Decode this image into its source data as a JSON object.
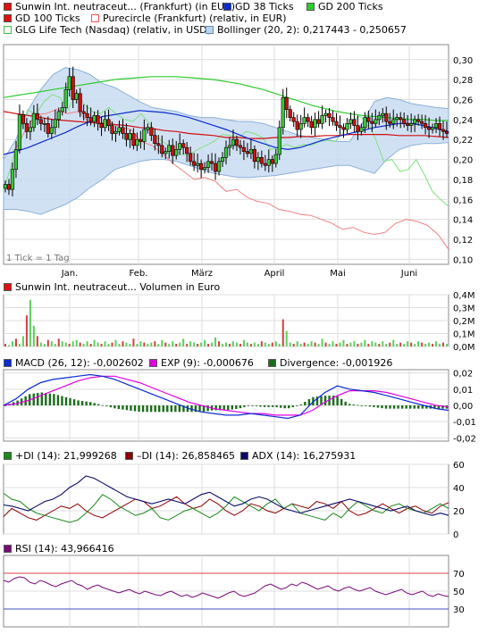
{
  "chart_data": [
    {
      "type": "candlestick",
      "legend": [
        {
          "label": "Sunwin Int. neutraceut... (Frankfurt) (in EUR)",
          "color": "#e01010",
          "style": "solid"
        },
        {
          "label": "GD 38 Ticks",
          "color": "#0a2bd0",
          "style": "solid"
        },
        {
          "label": "GD 200 Ticks",
          "color": "#2ecc2e",
          "style": "solid"
        },
        {
          "label": "GD 100 Ticks",
          "color": "#e01010",
          "style": "solid"
        },
        {
          "label": "Purecircle (Frankfurt) (relativ, in EUR)",
          "color": "#ff8080",
          "style": "solid"
        },
        {
          "label": "GLG Life Tech (Nasdaq) (relativ, in USD)",
          "color": "#8ef08e",
          "style": "solid"
        },
        {
          "label": "Bollinger (20, 2): 0,217443 - 0,250657",
          "color": "#b8d4f0",
          "style": "solid"
        }
      ],
      "tick_note": "1 Tick = 1 Tag",
      "x_labels": [
        "Jan.",
        "Feb.",
        "März",
        "April",
        "Mai",
        "Juni"
      ],
      "y_ticks": [
        "0,30",
        "0,28",
        "0,26",
        "0,24",
        "0,22",
        "0,20",
        "0,18",
        "0,16",
        "0,14",
        "0,12",
        "0,10"
      ],
      "ylim": [
        0.095,
        0.315
      ],
      "price_close": [
        0.175,
        0.17,
        0.19,
        0.21,
        0.245,
        0.236,
        0.228,
        0.232,
        0.246,
        0.24,
        0.236,
        0.236,
        0.226,
        0.232,
        0.24,
        0.248,
        0.252,
        0.27,
        0.283,
        0.26,
        0.266,
        0.248,
        0.246,
        0.242,
        0.238,
        0.244,
        0.236,
        0.232,
        0.24,
        0.234,
        0.226,
        0.228,
        0.232,
        0.226,
        0.22,
        0.226,
        0.214,
        0.22,
        0.218,
        0.23,
        0.232,
        0.224,
        0.216,
        0.214,
        0.206,
        0.208,
        0.214,
        0.204,
        0.21,
        0.216,
        0.212,
        0.206,
        0.198,
        0.194,
        0.196,
        0.19,
        0.192,
        0.198,
        0.196,
        0.188,
        0.198,
        0.202,
        0.212,
        0.214,
        0.22,
        0.214,
        0.212,
        0.208,
        0.206,
        0.21,
        0.198,
        0.202,
        0.196,
        0.194,
        0.2,
        0.196,
        0.205,
        0.232,
        0.262,
        0.25,
        0.242,
        0.238,
        0.23,
        0.236,
        0.242,
        0.238,
        0.232,
        0.24,
        0.236,
        0.244,
        0.246,
        0.242,
        0.238,
        0.234,
        0.232,
        0.23,
        0.236,
        0.24,
        0.234,
        0.228,
        0.232,
        0.242,
        0.238,
        0.236,
        0.24,
        0.244,
        0.246,
        0.238,
        0.236,
        0.24,
        0.242,
        0.24,
        0.236,
        0.234,
        0.236,
        0.24,
        0.238,
        0.236,
        0.232,
        0.23,
        0.232,
        0.236,
        0.23,
        0.228,
        0.226
      ],
      "gd38": [
        0.205,
        0.208,
        0.212,
        0.217,
        0.222,
        0.227,
        0.233,
        0.238,
        0.243,
        0.245,
        0.247,
        0.249,
        0.248,
        0.247,
        0.245,
        0.242,
        0.238,
        0.234,
        0.23,
        0.225,
        0.22,
        0.216,
        0.212,
        0.21,
        0.212,
        0.216,
        0.22,
        0.223,
        0.226,
        0.229,
        0.232,
        0.234,
        0.236,
        0.236,
        0.234,
        0.231,
        0.228
      ],
      "gd100": [
        0.248,
        0.246,
        0.244,
        0.242,
        0.24,
        0.239,
        0.238,
        0.237,
        0.236,
        0.235,
        0.234,
        0.232,
        0.231,
        0.229,
        0.228,
        0.226,
        0.225,
        0.224,
        0.222,
        0.222,
        0.221,
        0.221,
        0.222,
        0.222,
        0.223,
        0.223,
        0.224,
        0.224,
        0.225,
        0.225,
        0.225,
        0.225,
        0.224,
        0.224,
        0.224,
        0.223,
        0.222
      ],
      "gd200": [
        0.262,
        0.264,
        0.266,
        0.268,
        0.27,
        0.272,
        0.274,
        0.276,
        0.278,
        0.28,
        0.281,
        0.282,
        0.283,
        0.283,
        0.283,
        0.282,
        0.281,
        0.28,
        0.278,
        0.276,
        0.273,
        0.27,
        0.266,
        0.262,
        0.258,
        0.254,
        0.251,
        0.248,
        0.246,
        0.244,
        0.243,
        0.242,
        0.241,
        0.24,
        0.24,
        0.239,
        0.239
      ],
      "purecircle": [
        0.205,
        0.208,
        0.228,
        0.245,
        0.246,
        0.25,
        0.246,
        0.248,
        0.238,
        0.236,
        0.238,
        0.232,
        0.23,
        0.218,
        0.214,
        0.206,
        0.196,
        0.188,
        0.18,
        0.182,
        0.178,
        0.168,
        0.17,
        0.162,
        0.158,
        0.156,
        0.15,
        0.148,
        0.145,
        0.144,
        0.14,
        0.136,
        0.13,
        0.132,
        0.127,
        0.125,
        0.127,
        0.136,
        0.14,
        0.138,
        0.134,
        0.125,
        0.11
      ],
      "glg": [
        0.17,
        0.195,
        0.23,
        0.25,
        0.245,
        0.258,
        0.265,
        0.262,
        0.25,
        0.268,
        0.255,
        0.248,
        0.246,
        0.252,
        0.245,
        0.24,
        0.238,
        0.246,
        0.236,
        0.222,
        0.216,
        0.21,
        0.205,
        0.205,
        0.21,
        0.214,
        0.218,
        0.225,
        0.224,
        0.222,
        0.228,
        0.226,
        0.222,
        0.21,
        0.212,
        0.215,
        0.212,
        0.215,
        0.214,
        0.218,
        0.219,
        0.218,
        0.228,
        0.238,
        0.243,
        0.238,
        0.22,
        0.198,
        0.2,
        0.188,
        0.19,
        0.2,
        0.185,
        0.168,
        0.16,
        0.153
      ],
      "boll_upper": [
        0.2,
        0.22,
        0.25,
        0.27,
        0.285,
        0.292,
        0.29,
        0.285,
        0.276,
        0.272,
        0.265,
        0.258,
        0.252,
        0.25,
        0.248,
        0.244,
        0.242,
        0.242,
        0.24,
        0.238,
        0.238,
        0.236,
        0.232,
        0.228,
        0.224,
        0.222,
        0.22,
        0.218,
        0.218,
        0.236,
        0.258,
        0.262,
        0.26,
        0.256,
        0.254,
        0.252,
        0.251
      ],
      "boll_lower": [
        0.15,
        0.15,
        0.148,
        0.145,
        0.15,
        0.155,
        0.162,
        0.172,
        0.18,
        0.19,
        0.194,
        0.198,
        0.2,
        0.2,
        0.198,
        0.194,
        0.19,
        0.186,
        0.184,
        0.182,
        0.182,
        0.183,
        0.184,
        0.186,
        0.188,
        0.19,
        0.192,
        0.194,
        0.194,
        0.19,
        0.186,
        0.2,
        0.21,
        0.214,
        0.216,
        0.216,
        0.217
      ]
    },
    {
      "type": "bar",
      "title": "Sunwin Int. neutraceut... Volumen in Euro",
      "y_ticks": [
        "0,4M",
        "0,3M",
        "0,2M",
        "0,1M",
        "0,0M"
      ],
      "ylim": [
        0,
        0.4
      ],
      "unit": "M EUR",
      "values": [
        0.02,
        0.01,
        0.04,
        0.06,
        0.02,
        0.08,
        0.24,
        0.36,
        0.16,
        0.08,
        0.03,
        0.02,
        0.05,
        0.04,
        0.02,
        0.06,
        0.04,
        0.03,
        0.02,
        0.04,
        0.05,
        0.03,
        0.02,
        0.04,
        0.02,
        0.05,
        0.03,
        0.02,
        0.04,
        0.02,
        0.03,
        0.05,
        0.02,
        0.04,
        0.03,
        0.02,
        0.06,
        0.02,
        0.04,
        0.03,
        0.02,
        0.03,
        0.04,
        0.02,
        0.05,
        0.03,
        0.02,
        0.04,
        0.02,
        0.03,
        0.06,
        0.02,
        0.04,
        0.03,
        0.02,
        0.03,
        0.05,
        0.02,
        0.03,
        0.07,
        0.04,
        0.02,
        0.03,
        0.02,
        0.04,
        0.03,
        0.02,
        0.05,
        0.03,
        0.02,
        0.03,
        0.02,
        0.04,
        0.03,
        0.02,
        0.03,
        0.04,
        0.02,
        0.21,
        0.12,
        0.03,
        0.02,
        0.04,
        0.02,
        0.03,
        0.02,
        0.04,
        0.03,
        0.02,
        0.06,
        0.03,
        0.02,
        0.04,
        0.02,
        0.03,
        0.05,
        0.02,
        0.03,
        0.04,
        0.02,
        0.03,
        0.05,
        0.02,
        0.04,
        0.03,
        0.02,
        0.04,
        0.02,
        0.03,
        0.05,
        0.02,
        0.03,
        0.02,
        0.04,
        0.03,
        0.02,
        0.04,
        0.03,
        0.02,
        0.03,
        0.02,
        0.04,
        0.02,
        0.03,
        0.02
      ]
    },
    {
      "type": "line",
      "legend": [
        {
          "label": "MACD (26, 12): -0,002602",
          "color": "#0a2bd0"
        },
        {
          "label": "EXP (9): -0,000676",
          "color": "#e000e0"
        },
        {
          "label": "Divergence: -0,001926",
          "color": "#1a6b1a"
        }
      ],
      "y_ticks": [
        "0,02",
        "0,01",
        "0,00",
        "-0,01",
        "-0,02"
      ],
      "ylim": [
        -0.022,
        0.022
      ],
      "macd": [
        0.0,
        0.004,
        0.01,
        0.014,
        0.016,
        0.017,
        0.018,
        0.019,
        0.018,
        0.016,
        0.013,
        0.01,
        0.007,
        0.004,
        0.001,
        -0.002,
        -0.004,
        -0.005,
        -0.006,
        -0.006,
        -0.005,
        -0.006,
        -0.007,
        -0.008,
        -0.006,
        0.002,
        0.008,
        0.012,
        0.01,
        0.009,
        0.008,
        0.006,
        0.004,
        0.002,
        0.0,
        -0.002,
        -0.003
      ],
      "exp": [
        0.0,
        0.001,
        0.003,
        0.006,
        0.009,
        0.012,
        0.015,
        0.017,
        0.018,
        0.018,
        0.016,
        0.014,
        0.011,
        0.008,
        0.005,
        0.002,
        0.0,
        -0.002,
        -0.003,
        -0.004,
        -0.005,
        -0.005,
        -0.006,
        -0.006,
        -0.006,
        -0.003,
        0.002,
        0.006,
        0.009,
        0.009,
        0.009,
        0.008,
        0.006,
        0.004,
        0.002,
        0.0,
        -0.001
      ],
      "divergence": [
        0.0,
        0.003,
        0.007,
        0.008,
        0.007,
        0.005,
        0.003,
        0.002,
        0.0,
        -0.002,
        -0.003,
        -0.004,
        -0.004,
        -0.004,
        -0.004,
        -0.004,
        -0.004,
        -0.003,
        -0.003,
        -0.002,
        0.0,
        -0.001,
        -0.001,
        -0.002,
        0.0,
        0.005,
        0.006,
        0.006,
        0.001,
        0.0,
        -0.001,
        -0.002,
        -0.002,
        -0.002,
        -0.002,
        -0.002,
        -0.002
      ]
    },
    {
      "type": "line",
      "legend": [
        {
          "label": "+DI (14): 21,999268",
          "color": "#1a8a1a"
        },
        {
          "label": "–DI (14): 26,858465",
          "color": "#8b0000"
        },
        {
          "label": "ADX (14): 16,275931",
          "color": "#0a0a6b"
        }
      ],
      "y_ticks": [
        "60",
        "40",
        "20",
        "0"
      ],
      "ylim": [
        0,
        60
      ],
      "plus_di": [
        35,
        30,
        28,
        22,
        18,
        16,
        14,
        12,
        10,
        12,
        18,
        25,
        34,
        30,
        24,
        20,
        16,
        18,
        22,
        14,
        12,
        16,
        20,
        22,
        18,
        14,
        18,
        24,
        32,
        28,
        24,
        20,
        26,
        30,
        22,
        26,
        18,
        16,
        14,
        12,
        18,
        14,
        22,
        28,
        24,
        20,
        18,
        24,
        26,
        22,
        20,
        18,
        22,
        26,
        22
      ],
      "minus_di": [
        15,
        22,
        18,
        14,
        12,
        16,
        20,
        24,
        22,
        26,
        20,
        16,
        14,
        18,
        22,
        26,
        30,
        28,
        22,
        24,
        28,
        32,
        26,
        22,
        24,
        30,
        26,
        20,
        16,
        20,
        26,
        24,
        20,
        18,
        22,
        26,
        24,
        22,
        28,
        26,
        22,
        28,
        20,
        16,
        18,
        22,
        26,
        22,
        18,
        22,
        24,
        20,
        18,
        24,
        27
      ],
      "adx": [
        25,
        24,
        22,
        20,
        24,
        28,
        30,
        34,
        40,
        44,
        50,
        48,
        44,
        40,
        36,
        32,
        30,
        28,
        26,
        28,
        30,
        28,
        26,
        30,
        34,
        36,
        32,
        28,
        24,
        26,
        30,
        32,
        30,
        26,
        22,
        20,
        18,
        20,
        22,
        24,
        26,
        28,
        30,
        28,
        26,
        24,
        22,
        20,
        22,
        24,
        20,
        18,
        16,
        18,
        16
      ]
    },
    {
      "type": "line",
      "legend": [
        {
          "label": "RSI (14): 43,966416",
          "color": "#7a0a7a"
        }
      ],
      "y_ticks": [
        "70",
        "50",
        "30"
      ],
      "ylim": [
        10,
        90
      ],
      "ref_lines": [
        70,
        30
      ],
      "rsi": [
        62,
        60,
        64,
        66,
        65,
        60,
        58,
        62,
        60,
        57,
        55,
        58,
        60,
        62,
        58,
        56,
        52,
        55,
        57,
        54,
        52,
        50,
        48,
        50,
        52,
        49,
        47,
        50,
        48,
        46,
        45,
        48,
        50,
        47,
        44,
        46,
        43,
        45,
        48,
        46,
        44,
        42,
        45,
        48,
        50,
        46,
        44,
        46,
        48,
        52,
        56,
        58,
        55,
        52,
        54,
        58,
        56,
        60,
        58,
        55,
        52,
        54,
        56,
        52,
        50,
        53,
        55,
        52,
        50,
        52,
        54,
        50,
        48,
        46,
        48,
        50,
        52,
        48,
        46,
        48,
        50,
        46,
        44,
        47,
        45,
        44
      ]
    }
  ]
}
